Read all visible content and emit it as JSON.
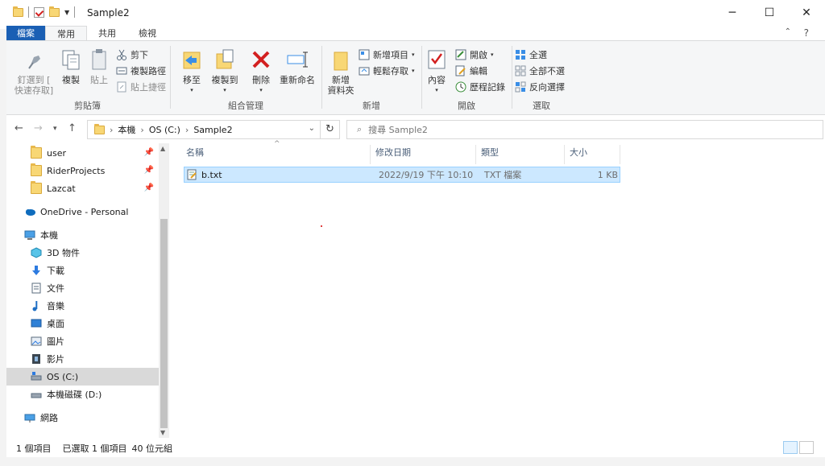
{
  "window": {
    "title": "Sample2",
    "controls": [
      "─",
      "☐",
      "✕"
    ]
  },
  "ribbon_tabs": [
    {
      "label": "檔案"
    },
    {
      "label": "常用"
    },
    {
      "label": "共用"
    },
    {
      "label": "檢視"
    }
  ],
  "help": "?",
  "clipboard": {
    "pin": "釘選到 [\n快速存取]",
    "copy": "複製",
    "paste": "貼上",
    "cut": "剪下",
    "copy_path": "複製路徑",
    "paste_shortcut": "貼上捷徑",
    "group": "剪貼簿"
  },
  "organize": {
    "move": "移至",
    "copy_to": "複製到",
    "delete": "刪除",
    "rename": "重新命名",
    "group": "組合管理"
  },
  "new": {
    "new_folder": "新增\n資料夾",
    "new_item": "新增項目",
    "easy_access": "輕鬆存取",
    "group": "新增"
  },
  "open": {
    "properties": "內容",
    "open": "開啟",
    "edit": "編輯",
    "history": "歷程記錄",
    "group": "開啟"
  },
  "select": {
    "select_all": "全選",
    "select_none": "全部不選",
    "invert": "反向選擇",
    "group": "選取"
  },
  "address": {
    "crumbs": [
      "本機",
      "OS (C:)",
      "Sample2"
    ]
  },
  "search": {
    "placeholder": "搜尋 Sample2"
  },
  "nav": {
    "quick": [
      {
        "label": "user"
      },
      {
        "label": "RiderProjects"
      },
      {
        "label": "Lazcat"
      }
    ],
    "onedrive": "OneDrive - Personal",
    "this_pc": "本機",
    "pc_items": [
      {
        "label": "3D 物件"
      },
      {
        "label": "下載"
      },
      {
        "label": "文件"
      },
      {
        "label": "音樂"
      },
      {
        "label": "桌面"
      },
      {
        "label": "圖片"
      },
      {
        "label": "影片"
      },
      {
        "label": "OS (C:)"
      },
      {
        "label": "本機磁碟 (D:)"
      }
    ],
    "network": "網路"
  },
  "columns": [
    "名稱",
    "修改日期",
    "類型",
    "大小"
  ],
  "files": [
    {
      "name": "b.txt",
      "modified": "2022/9/19 下午 10:10",
      "type": "TXT 檔案",
      "size": "1 KB"
    }
  ],
  "status": {
    "count": "1 個項目",
    "selected": "已選取 1 個項目",
    "size": "40 位元組"
  },
  "colors": {
    "accent": "#1a5fb4",
    "selection": "#cce8ff",
    "folder": "#f8d775"
  }
}
